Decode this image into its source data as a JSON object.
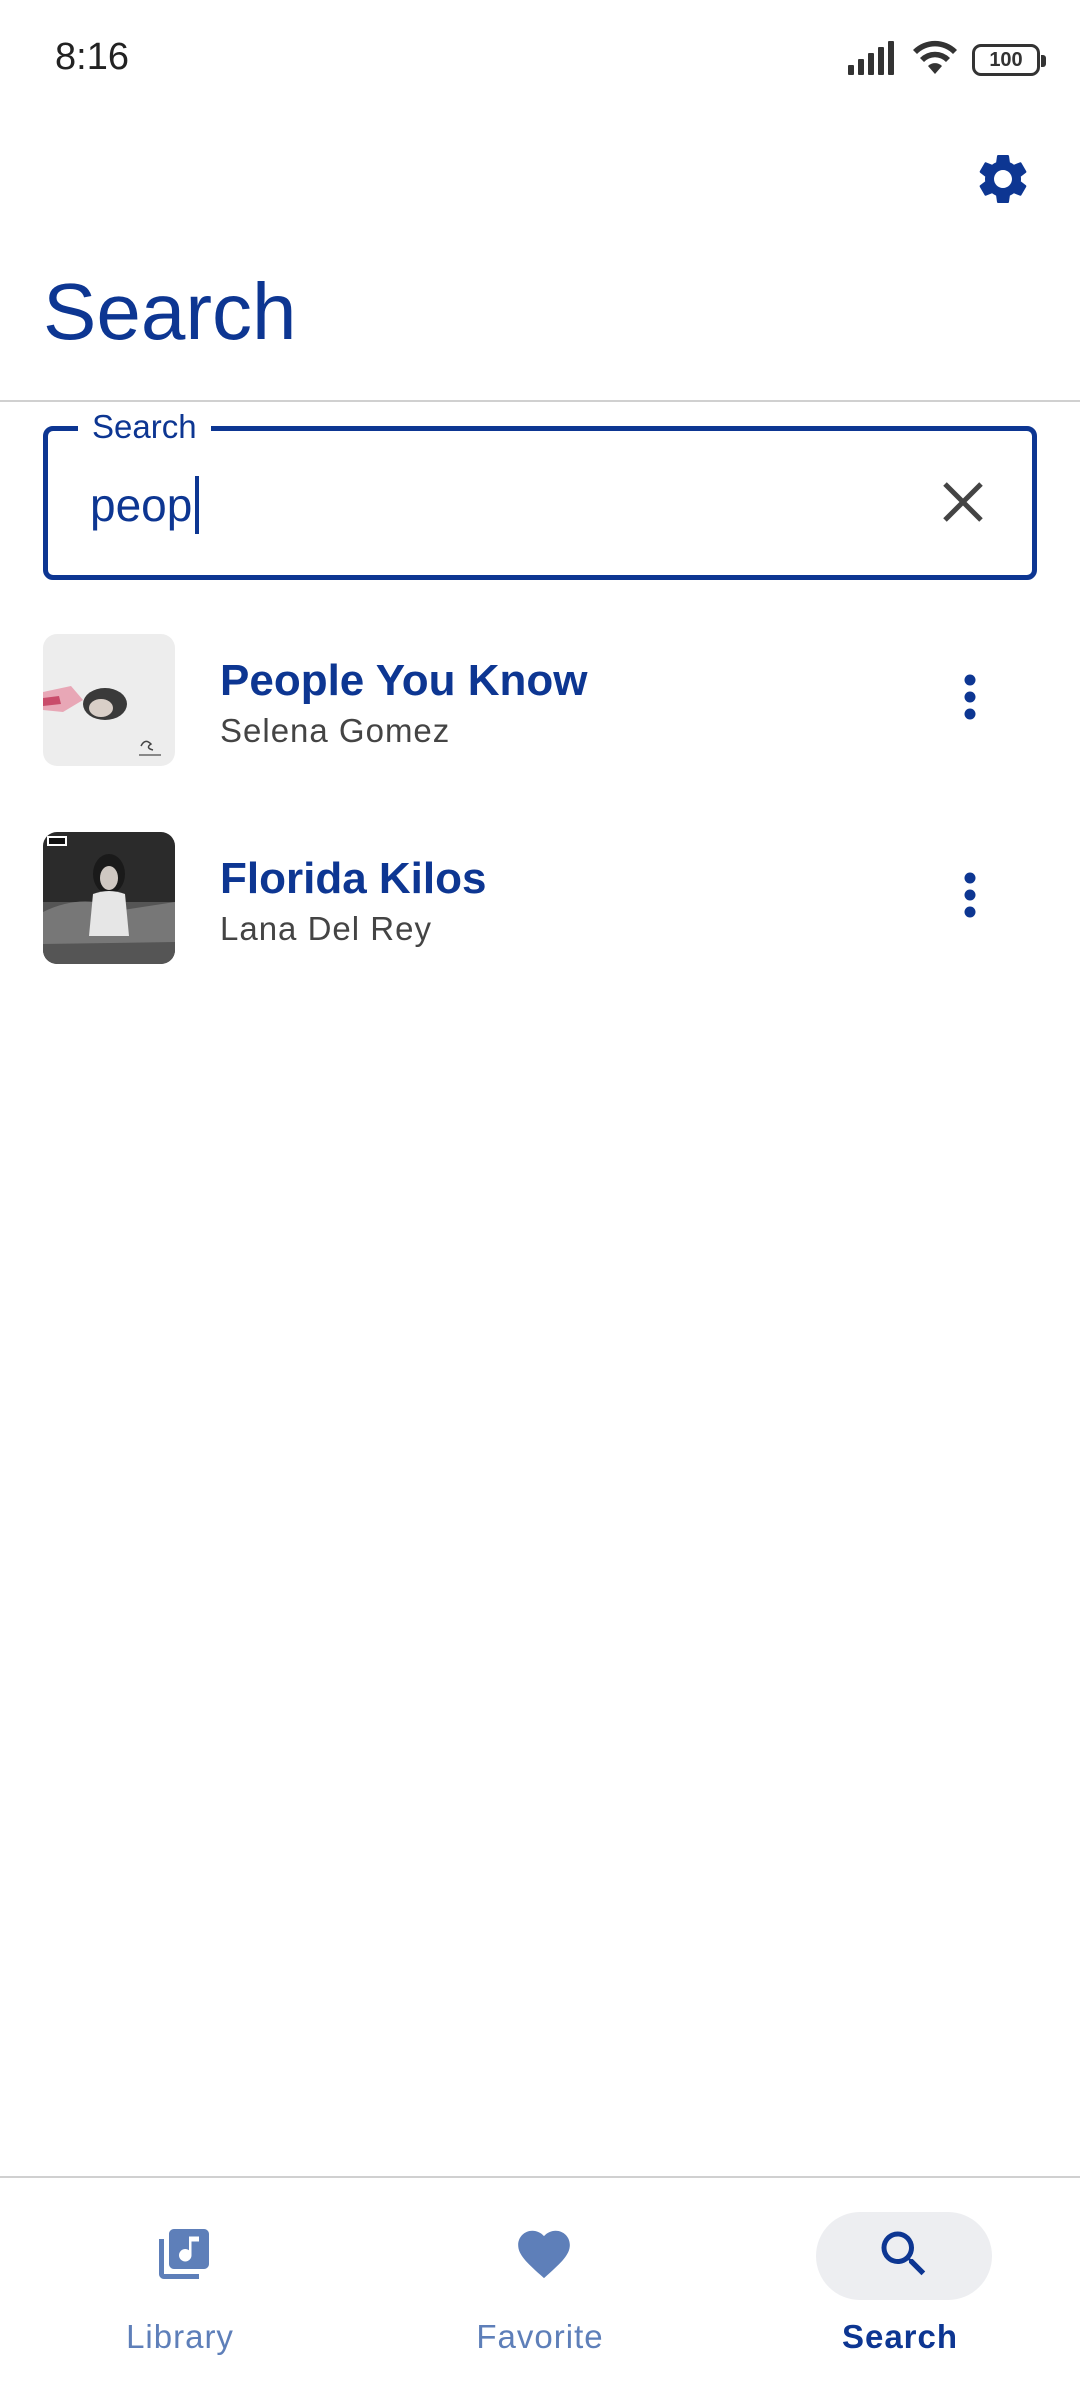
{
  "status_bar": {
    "time": "8:16",
    "battery": "100",
    "icons": [
      "signal-icon",
      "wifi-icon",
      "battery-icon"
    ]
  },
  "header": {
    "title": "Search",
    "settings_icon": "gear-icon"
  },
  "search": {
    "label": "Search",
    "value": "peop",
    "clear_icon": "close-icon"
  },
  "results": [
    {
      "title": "People You Know",
      "artist": "Selena Gomez",
      "art_style": "light"
    },
    {
      "title": "Florida Kilos",
      "artist": "Lana Del Rey",
      "art_style": "dark"
    }
  ],
  "bottom_nav": {
    "items": [
      {
        "label": "Library",
        "icon": "library-music-icon",
        "active": false
      },
      {
        "label": "Favorite",
        "icon": "heart-icon",
        "active": false
      },
      {
        "label": "Search",
        "icon": "search-icon",
        "active": true
      }
    ]
  },
  "colors": {
    "primary": "#0D3692",
    "inactive_nav": "#5E7FB9",
    "active_pill": "#EDEEF1",
    "divider": "#d0d0d0"
  }
}
